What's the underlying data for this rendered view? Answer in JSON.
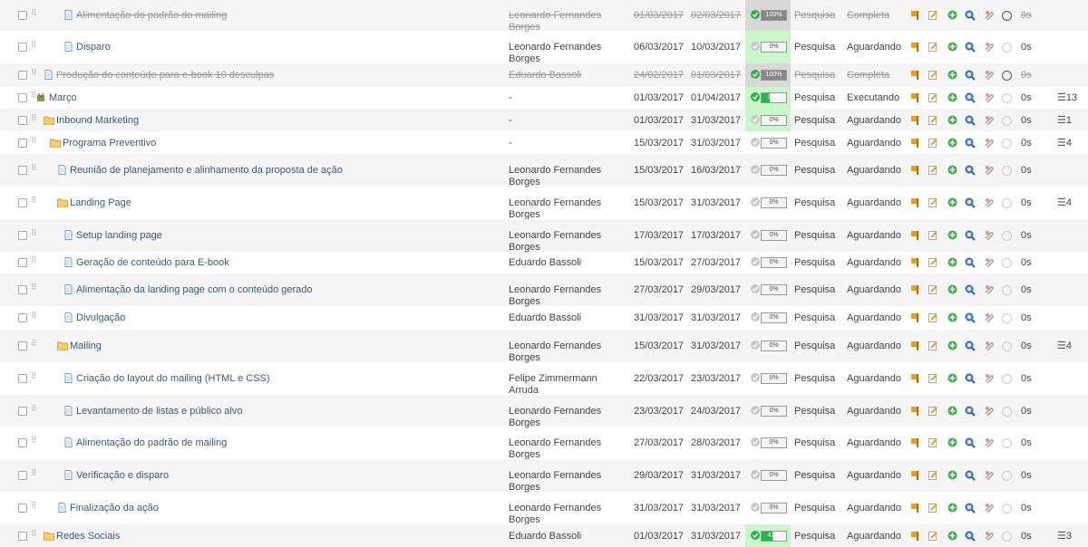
{
  "tasks": [
    {
      "name": "Alimentação do padrão do mailing",
      "responsible": "Leonardo Fernandes Borges",
      "start": "01/03/2017",
      "end": "02/03/2017",
      "progress": 100,
      "category": "Pesquisa",
      "status": "Completa",
      "time": "0s",
      "subtasks": "",
      "icon": "document-icon",
      "done": true
    },
    {
      "name": "Disparo",
      "responsible": "Leonardo Fernandes Borges",
      "start": "06/03/2017",
      "end": "10/03/2017",
      "progress": 0,
      "category": "Pesquisa",
      "status": "Aguardando",
      "time": "0s",
      "subtasks": "",
      "icon": "document-icon",
      "done": false
    },
    {
      "name": "Produção do conteúdo para e-book 10 desculpas",
      "responsible": "Eduardo Bassoli",
      "start": "24/02/2017",
      "end": "01/03/2017",
      "progress": 100,
      "category": "Pesquisa",
      "status": "Completa",
      "time": "0s",
      "subtasks": "",
      "icon": "document-icon",
      "done": true
    },
    {
      "name": "Março",
      "responsible": "-",
      "start": "01/03/2017",
      "end": "01/04/2017",
      "progress": 34,
      "category": "Pesquisa",
      "status": "Executando",
      "time": "0s",
      "subtasks": "13",
      "icon": "milestone-icon",
      "done": false
    },
    {
      "name": "Inbound Marketing",
      "responsible": "-",
      "start": "01/03/2017",
      "end": "31/03/2017",
      "progress": 0,
      "category": "Pesquisa",
      "status": "Aguardando",
      "time": "0s",
      "subtasks": "1",
      "icon": "folder-icon",
      "done": false
    },
    {
      "name": "Programa Preventivo",
      "responsible": "-",
      "start": "15/03/2017",
      "end": "31/03/2017",
      "progress": 0,
      "category": "Pesquisa",
      "status": "Aguardando",
      "time": "0s",
      "subtasks": "4",
      "icon": "folder-icon",
      "done": false
    },
    {
      "name": "Reunião de planejamento e alinhamento da proposta de ação",
      "responsible": "Leonardo Fernandes Borges",
      "start": "15/03/2017",
      "end": "16/03/2017",
      "progress": 0,
      "category": "Pesquisa",
      "status": "Aguardando",
      "time": "0s",
      "subtasks": "",
      "icon": "document-icon",
      "done": false
    },
    {
      "name": "Landing Page",
      "responsible": "Leonardo Fernandes Borges",
      "start": "15/03/2017",
      "end": "31/03/2017",
      "progress": 0,
      "category": "Pesquisa",
      "status": "Aguardando",
      "time": "0s",
      "subtasks": "4",
      "icon": "folder-icon",
      "done": false
    },
    {
      "name": "Setup landing page",
      "responsible": "Leonardo Fernandes Borges",
      "start": "17/03/2017",
      "end": "17/03/2017",
      "progress": 0,
      "category": "Pesquisa",
      "status": "Aguardando",
      "time": "0s",
      "subtasks": "",
      "icon": "document-icon",
      "done": false
    },
    {
      "name": "Geração de conteúdo para E-book",
      "responsible": "Eduardo Bassoli",
      "start": "15/03/2017",
      "end": "27/03/2017",
      "progress": 0,
      "category": "Pesquisa",
      "status": "Aguardando",
      "time": "0s",
      "subtasks": "",
      "icon": "document-icon",
      "done": false
    },
    {
      "name": "Alimentação da landing page com o conteúdo gerado",
      "responsible": "Leonardo Fernandes Borges",
      "start": "27/03/2017",
      "end": "29/03/2017",
      "progress": 0,
      "category": "Pesquisa",
      "status": "Aguardando",
      "time": "0s",
      "subtasks": "",
      "icon": "document-icon",
      "done": false
    },
    {
      "name": "Divulgação",
      "responsible": "Eduardo Bassoli",
      "start": "31/03/2017",
      "end": "31/03/2017",
      "progress": 0,
      "category": "Pesquisa",
      "status": "Aguardando",
      "time": "0s",
      "subtasks": "",
      "icon": "document-icon",
      "done": false
    },
    {
      "name": "Mailing",
      "responsible": "Leonardo Fernandes Borges",
      "start": "15/03/2017",
      "end": "31/03/2017",
      "progress": 0,
      "category": "Pesquisa",
      "status": "Aguardando",
      "time": "0s",
      "subtasks": "4",
      "icon": "folder-icon",
      "done": false
    },
    {
      "name": "Criação do layout do mailing (HTML e CSS)",
      "responsible": "Felipe Zimmermann Arruda",
      "start": "22/03/2017",
      "end": "23/03/2017",
      "progress": 0,
      "category": "Pesquisa",
      "status": "Aguardando",
      "time": "0s",
      "subtasks": "",
      "icon": "document-icon",
      "done": false
    },
    {
      "name": "Levantamento de listas e público alvo",
      "responsible": "Leonardo Fernandes Borges",
      "start": "23/03/2017",
      "end": "24/03/2017",
      "progress": 0,
      "category": "Pesquisa",
      "status": "Aguardando",
      "time": "0s",
      "subtasks": "",
      "icon": "document-icon",
      "done": false
    },
    {
      "name": "Alimentação do padrão de mailing",
      "responsible": "Leonardo Fernandes Borges",
      "start": "27/03/2017",
      "end": "28/03/2017",
      "progress": 0,
      "category": "Pesquisa",
      "status": "Aguardando",
      "time": "0s",
      "subtasks": "",
      "icon": "document-icon",
      "done": false
    },
    {
      "name": "Verificação e disparo",
      "responsible": "Leonardo Fernandes Borges",
      "start": "29/03/2017",
      "end": "31/03/2017",
      "progress": 0,
      "category": "Pesquisa",
      "status": "Aguardando",
      "time": "0s",
      "subtasks": "",
      "icon": "document-icon",
      "done": false
    },
    {
      "name": "Finalização da ação",
      "responsible": "Leonardo Fernandes Borges",
      "start": "31/03/2017",
      "end": "31/03/2017",
      "progress": 0,
      "category": "Pesquisa",
      "status": "Aguardando",
      "time": "0s",
      "subtasks": "",
      "icon": "document-icon",
      "done": false
    },
    {
      "name": "Redes Sociais",
      "responsible": "Eduardo Bassoli",
      "start": "01/03/2017",
      "end": "31/03/2017",
      "progress": 47,
      "category": "Pesquisa",
      "status": "Aguardando",
      "time": "0s",
      "subtasks": "3",
      "icon": "folder-icon",
      "done": false
    }
  ],
  "colors": {
    "progress_active": "#2bb24c",
    "progress_done": "#888888",
    "active_cell_bg": "#c9f7c9",
    "link": "#3a5a7c",
    "alt_row": "#f5f5f5"
  }
}
